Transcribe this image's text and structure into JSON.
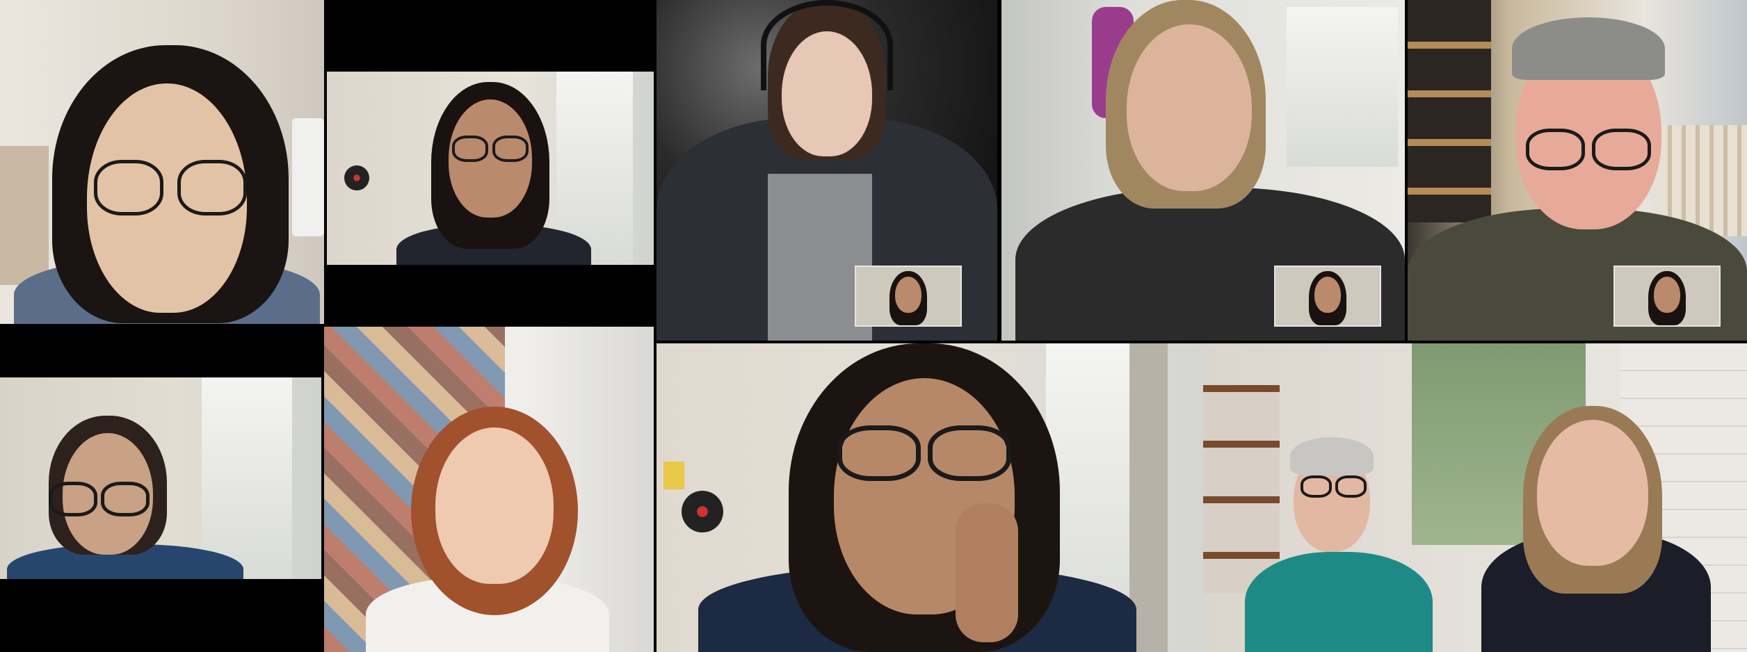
{
  "meeting": {
    "layout": "gallery",
    "participant_count": 10
  },
  "tiles": [
    {
      "id": "p1",
      "scene": "bookshelf-wall",
      "shirt": "#5a6e8a",
      "hair": "#1a1412",
      "skin": "#e3c3a6",
      "glasses": true,
      "pip": false
    },
    {
      "id": "p2",
      "scene": "office-window",
      "shirt": "#22252e",
      "hair": "#1a1210",
      "skin": "#b98a6c",
      "glasses": true,
      "pip": false
    },
    {
      "id": "p3",
      "scene": "blurred-dark",
      "shirt": "#2c2f36",
      "hair": "#3c2a20",
      "skin": "#e7c7b5",
      "glasses": false,
      "headset": true,
      "pip": true
    },
    {
      "id": "p4",
      "scene": "office-window",
      "shirt": "#2b2b2b",
      "hair": "#a08760",
      "skin": "#dcb49c",
      "glasses": false,
      "pip": true
    },
    {
      "id": "p5",
      "scene": "studio-shelves",
      "shirt": "#4a4a3c",
      "hair": "#8c8c88",
      "skin": "#e8aa98",
      "glasses": true,
      "pip": true
    },
    {
      "id": "p6",
      "scene": "office-window",
      "shirt": "#27466e",
      "hair": "#2c211c",
      "skin": "#c9a184",
      "glasses": true,
      "pip": false
    },
    {
      "id": "p7",
      "scene": "quilt-wall",
      "shirt": "#f2f0ec",
      "hair": "#a1512c",
      "skin": "#efc9b0",
      "glasses": false,
      "pip": false
    },
    {
      "id": "p8",
      "scene": "office-window",
      "shirt": "#1c2a44",
      "hair": "#1c1411",
      "skin": "#b78868",
      "glasses": true,
      "pip": false
    },
    {
      "id": "p9",
      "scene": "classroom",
      "shirt": "#1e8a86",
      "hair": "#c8c6c2",
      "skin": "#e2b8a2",
      "glasses": true,
      "pip": false
    },
    {
      "id": "p10",
      "scene": "classroom",
      "shirt": "#1b1e28",
      "hair": "#9a7a55",
      "skin": "#e6bba4",
      "glasses": false,
      "pip": false
    }
  ]
}
